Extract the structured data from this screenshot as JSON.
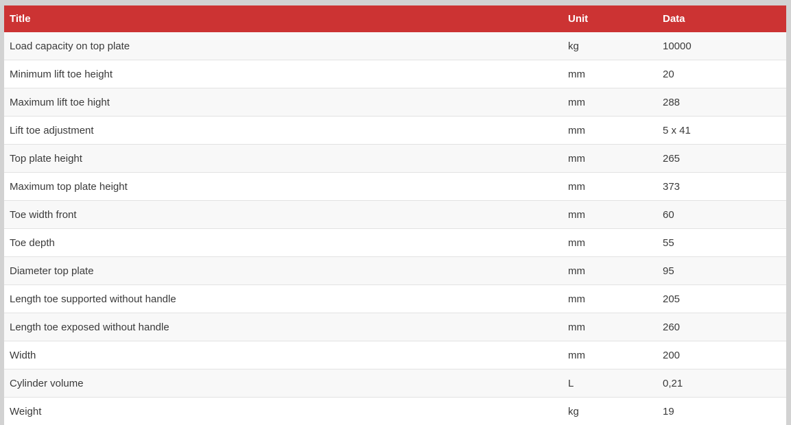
{
  "table": {
    "headers": {
      "title": "Title",
      "unit": "Unit",
      "data": "Data"
    },
    "rows": [
      {
        "title": "Load capacity on top plate",
        "unit": "kg",
        "data": "10000"
      },
      {
        "title": "Minimum lift toe height",
        "unit": "mm",
        "data": "20"
      },
      {
        "title": "Maximum lift toe hight",
        "unit": "mm",
        "data": "288"
      },
      {
        "title": "Lift toe adjustment",
        "unit": "mm",
        "data": "5 x 41"
      },
      {
        "title": "Top plate height",
        "unit": "mm",
        "data": "265"
      },
      {
        "title": "Maximum top plate height",
        "unit": "mm",
        "data": "373"
      },
      {
        "title": "Toe width front",
        "unit": "mm",
        "data": "60"
      },
      {
        "title": "Toe depth",
        "unit": "mm",
        "data": "55"
      },
      {
        "title": "Diameter top plate",
        "unit": "mm",
        "data": "95"
      },
      {
        "title": "Length toe supported without handle",
        "unit": "mm",
        "data": "205"
      },
      {
        "title": "Length toe exposed without handle",
        "unit": "mm",
        "data": "260"
      },
      {
        "title": "Width",
        "unit": "mm",
        "data": "200"
      },
      {
        "title": "Cylinder volume",
        "unit": "L",
        "data": "0,21"
      },
      {
        "title": "Weight",
        "unit": "kg",
        "data": "19"
      }
    ]
  },
  "colors": {
    "header_background": "#cc3333",
    "header_text": "#ffffff",
    "row_odd": "#f8f8f8",
    "row_even": "#ffffff",
    "page_background": "#d2d2d2"
  }
}
